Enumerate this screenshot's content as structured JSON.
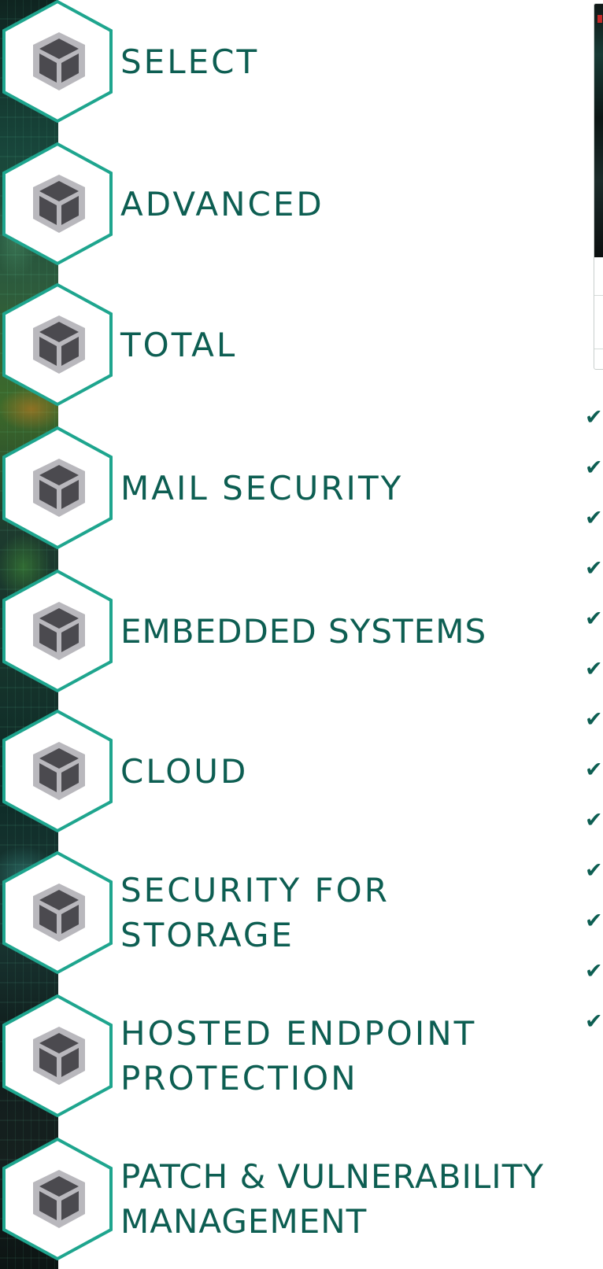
{
  "colors": {
    "label_text": "#0d5e52",
    "hex_border": "#1ea58e",
    "cube_dark": "#4b4a4f",
    "cube_light": "#b9b8bd",
    "check": "#0d5e52"
  },
  "menu": {
    "items": [
      {
        "id": "select",
        "icon": "cube-icon",
        "lines": [
          "SELECT"
        ]
      },
      {
        "id": "advanced",
        "icon": "cube-icon",
        "lines": [
          "ADVANCED"
        ]
      },
      {
        "id": "total",
        "icon": "cube-icon",
        "lines": [
          "TOTAL"
        ]
      },
      {
        "id": "mail-security",
        "icon": "cube-icon",
        "lines": [
          "MAIL SECURITY"
        ]
      },
      {
        "id": "embedded-systems",
        "icon": "cube-icon",
        "lines": [
          "EMBEDDED SYSTEMS"
        ]
      },
      {
        "id": "cloud",
        "icon": "cube-icon",
        "lines": [
          "CLOUD"
        ]
      },
      {
        "id": "security-for-storage",
        "icon": "cube-icon",
        "lines": [
          "SECURITY FOR",
          "STORAGE"
        ]
      },
      {
        "id": "hosted-endpoint-protection",
        "icon": "cube-icon",
        "lines": [
          "HOSTED ENDPOINT",
          "PROTECTION"
        ]
      },
      {
        "id": "patch-vulnerability-management",
        "icon": "cube-icon",
        "lines": [
          "PATCH & VULNERABILITY",
          "MANAGEMENT"
        ]
      }
    ]
  },
  "checks": {
    "icon": "check-icon",
    "glyph": "✔",
    "count": 13
  }
}
